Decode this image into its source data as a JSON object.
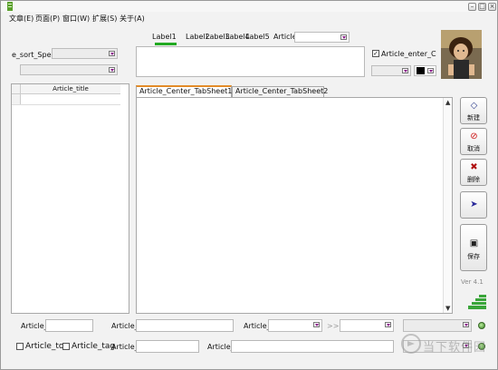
{
  "menu": {
    "items": [
      "文章(E)",
      "页面(P)",
      "窗口(W)",
      "扩展(S)",
      "关于(A)"
    ]
  },
  "top": {
    "sort_label": "e_sort_Spe",
    "tabs": [
      "Label1",
      "Label2",
      "Label3",
      "Label4",
      "Label5"
    ],
    "article_label": "Article_",
    "enter_label": "Article_enter_C",
    "enter_checked_mark": "✓"
  },
  "left_panel": {
    "column_header": "Article_title"
  },
  "center": {
    "tabs": [
      "Article_Center_TabSheet1",
      "Article_Center_TabSheet2"
    ]
  },
  "side_buttons": {
    "new": "新建",
    "cancel": "取消",
    "delete": "删除",
    "save": "保存"
  },
  "version": "Ver 4.1",
  "bottom": {
    "row1": {
      "label_a": "Article_p",
      "label_b": "Article_",
      "label_c": "Article_s",
      "arrows": ">>"
    },
    "row2": {
      "check_top": "Article_top",
      "check_tag": "Article_tag",
      "label_a": "Article_a",
      "label_b": "Article_s"
    }
  },
  "watermark": "当下软件园",
  "colors": {
    "tab_underline": "#22aa22",
    "tab_active_border": "#e38b28",
    "dropdown_arrow": "#8a1a8a",
    "swatch": "#000000",
    "send_arrow": "#2a2a9a",
    "cancel_icon": "#cc1111"
  }
}
